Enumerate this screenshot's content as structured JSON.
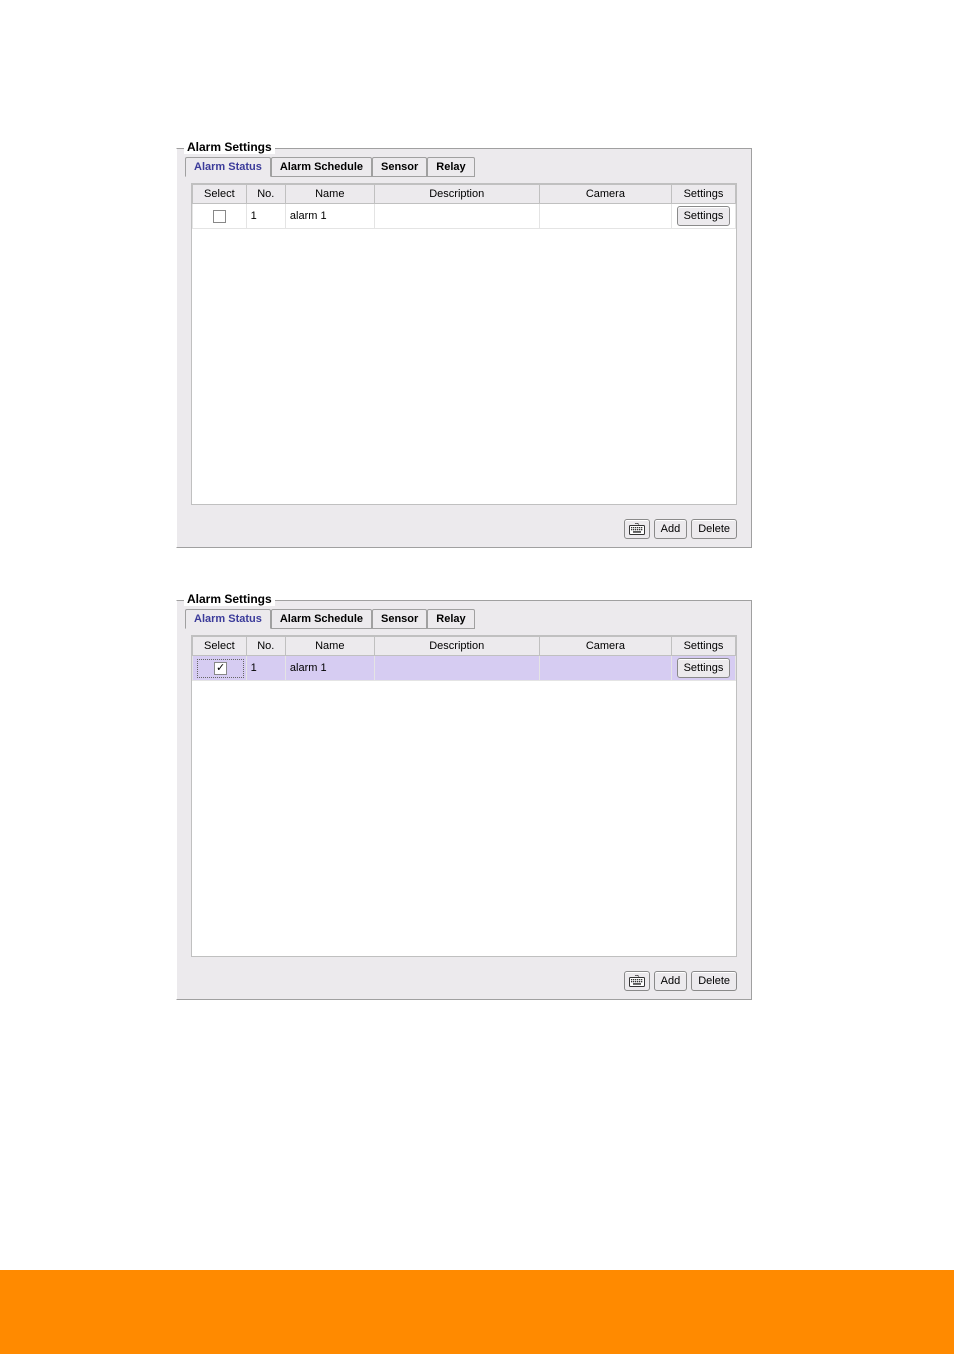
{
  "panels": [
    {
      "title": "Alarm Settings",
      "tabs": [
        "Alarm Status",
        "Alarm Schedule",
        "Sensor",
        "Relay"
      ],
      "active_tab": 0,
      "columns": [
        "Select",
        "No.",
        "Name",
        "Description",
        "Camera",
        "Settings"
      ],
      "rows": [
        {
          "selected": false,
          "checked": false,
          "focused": false,
          "no": "1",
          "name": "alarm 1",
          "description": "",
          "camera": "",
          "settings_label": "Settings"
        }
      ],
      "footer": {
        "keyboard_title": "On-screen keyboard",
        "add_label": "Add",
        "delete_label": "Delete"
      }
    },
    {
      "title": "Alarm Settings",
      "tabs": [
        "Alarm Status",
        "Alarm Schedule",
        "Sensor",
        "Relay"
      ],
      "active_tab": 0,
      "columns": [
        "Select",
        "No.",
        "Name",
        "Description",
        "Camera",
        "Settings"
      ],
      "rows": [
        {
          "selected": true,
          "checked": true,
          "focused": true,
          "no": "1",
          "name": "alarm 1",
          "description": "",
          "camera": "",
          "settings_label": "Settings"
        }
      ],
      "footer": {
        "keyboard_title": "On-screen keyboard",
        "add_label": "Add",
        "delete_label": "Delete"
      }
    }
  ]
}
